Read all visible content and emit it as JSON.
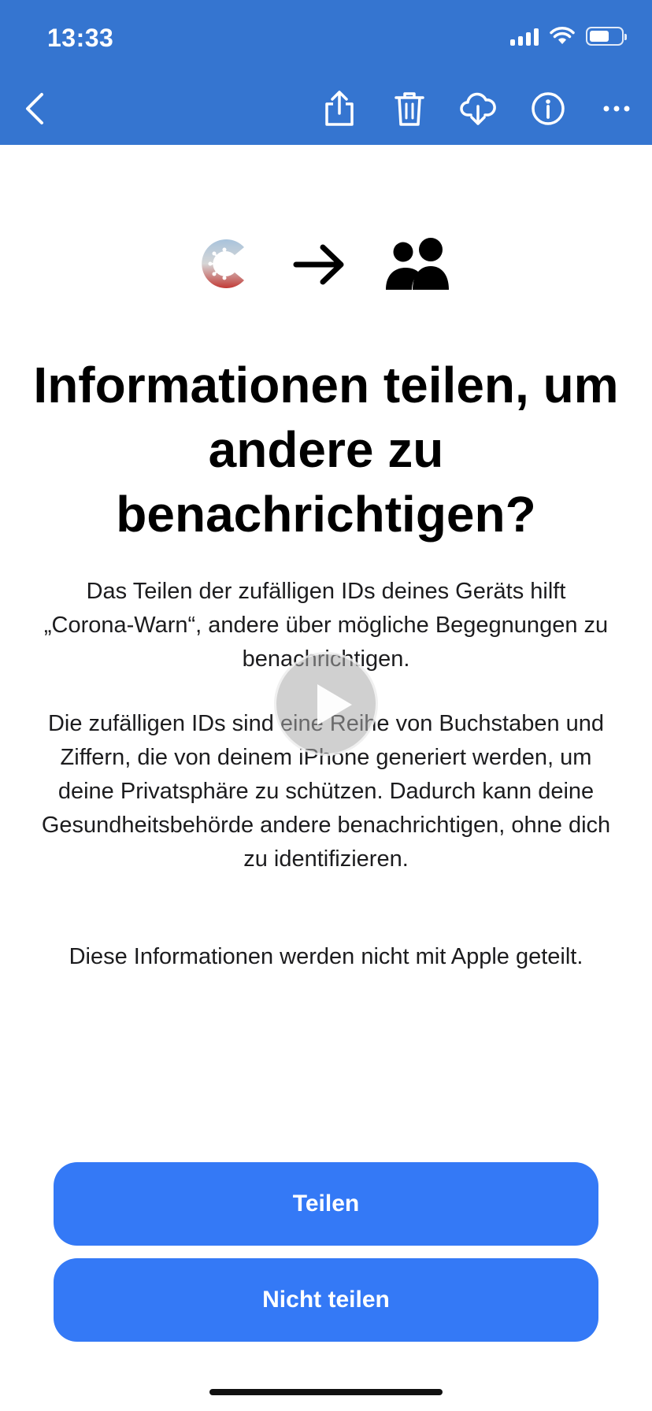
{
  "status_bar": {
    "time": "13:33",
    "battery_level": 0.55
  },
  "toolbar": {
    "icons": [
      "back-chevron-icon",
      "share-icon",
      "trash-icon",
      "cloud-download-icon",
      "info-icon",
      "more-icon"
    ],
    "background_color": "#3575d0"
  },
  "hero": {
    "icons": [
      "corona-warn-app-icon",
      "arrow-right-icon",
      "people-icon"
    ]
  },
  "content": {
    "title": "Informationen teilen, um andere zu benachrichtigen?",
    "paragraph_1": "Das Teilen der zufälligen IDs deines Geräts hilft „Corona-Warn“, andere über mögliche Begegnungen zu benachrichtigen.",
    "paragraph_2": "Die zufälligen IDs sind eine Reihe von Buchstaben und Ziffern, die von deinem iPhone generiert werden, um deine Privatsphäre zu schützen. Dadurch kann deine Gesundheitsbehörde andere benachrichtigen, ohne dich zu identifizieren.",
    "paragraph_3": "Diese Informationen werden nicht mit Apple geteilt."
  },
  "buttons": {
    "share_label": "Teilen",
    "decline_label": "Nicht teilen",
    "color": "#3479f6"
  }
}
